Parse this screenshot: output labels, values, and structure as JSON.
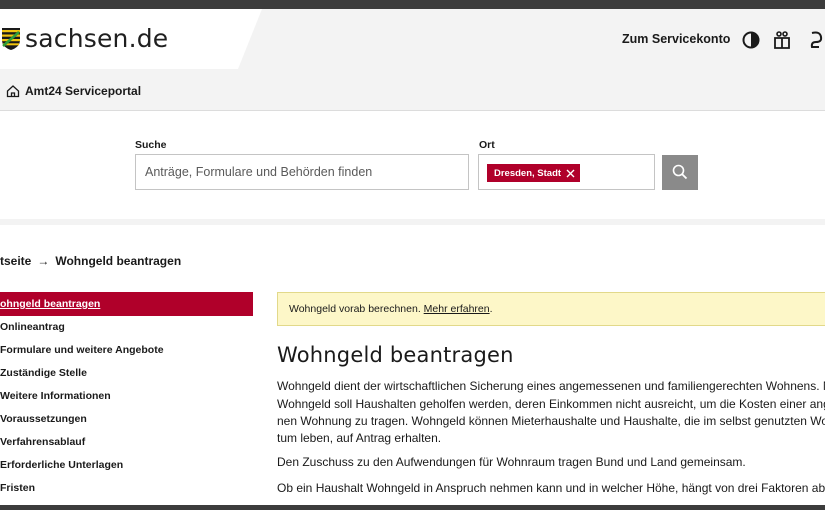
{
  "header": {
    "logo_text": "sachsen.de",
    "service_link": "Zum Servicekonto",
    "icons": [
      "contrast-icon",
      "sign-language-icon",
      "easy-language-icon"
    ]
  },
  "navbar": {
    "home_icon": "home-icon",
    "title": "Amt24 Serviceportal"
  },
  "search": {
    "label": "Suche",
    "placeholder": "Anträge, Formulare und Behörden finden",
    "location_label": "Ort",
    "location_chip": "Dresden, Stadt",
    "button_icon": "search-icon"
  },
  "breadcrumb": {
    "parent": "tseite",
    "separator": "→",
    "current": "Wohngeld beantragen"
  },
  "sidebar": {
    "items": [
      {
        "label": "ohngeld beantragen",
        "active": true
      },
      {
        "label": "Onlineantrag"
      },
      {
        "label": "Formulare und weitere Angebote"
      },
      {
        "label": "Zuständige Stelle"
      },
      {
        "label": "Weitere Informationen"
      },
      {
        "label": "Voraussetzungen"
      },
      {
        "label": "Verfahrensablauf"
      },
      {
        "label": "Erforderliche Unterlagen"
      },
      {
        "label": "Fristen"
      }
    ]
  },
  "notice": {
    "text": "Wohngeld vorab berechnen.",
    "link": "Mehr erfahren",
    "suffix": "."
  },
  "main": {
    "title": "Wohngeld beantragen",
    "paragraph1": [
      "Wohngeld dient der wirtschaftlichen Sicherung eines angemessenen und familiengerechten Wohnens. Mit de",
      "Wohngeld soll Haushalten geholfen werden, deren Einkommen nicht ausreicht, um die Kosten einer angeme",
      "nen Wohnung zu tragen. Wohngeld können Mieterhaushalte und Haushalte, die im selbst genutzten Wohneig",
      "tum leben, auf Antrag erhalten."
    ],
    "paragraph2": "Den Zuschuss zu den Aufwendungen für Wohnraum tragen Bund und Land gemeinsam.",
    "paragraph3": "Ob ein Haushalt Wohngeld in Anspruch nehmen kann und in welcher Höhe, hängt von drei Faktoren ab:"
  },
  "colors": {
    "brand_red": "#b0002a",
    "notice_bg": "#fdf7c8",
    "search_button": "#8a8a8a"
  }
}
